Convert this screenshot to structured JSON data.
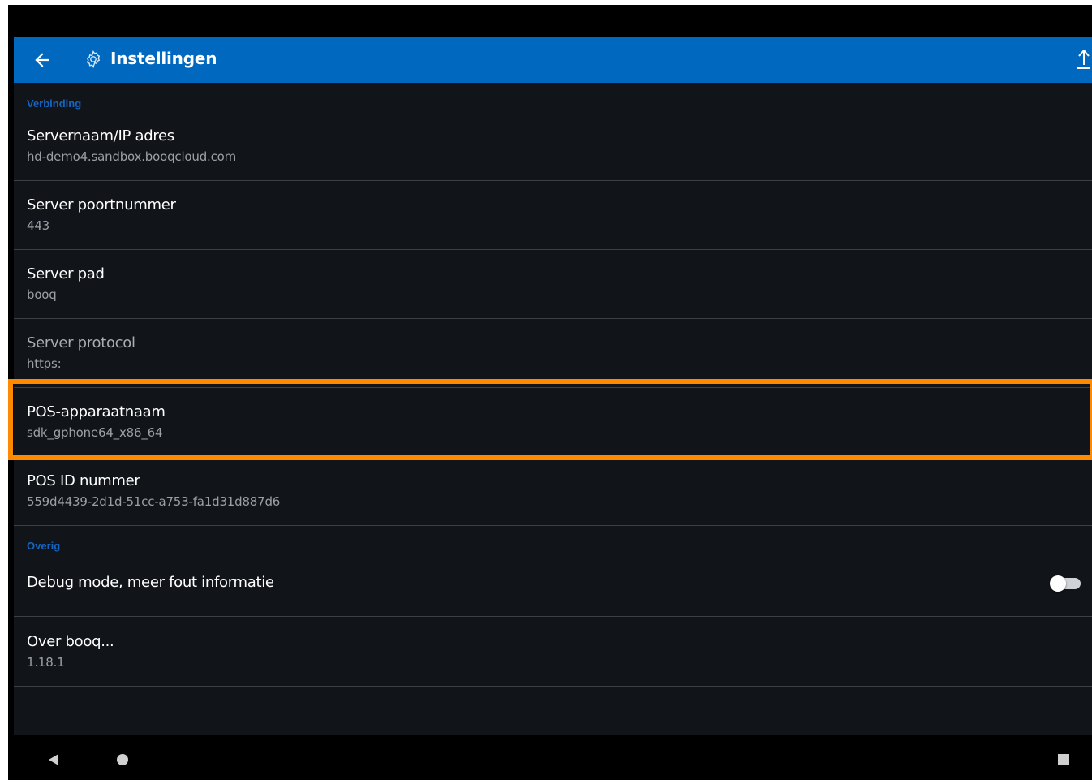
{
  "appbar": {
    "title": "Instellingen",
    "accent_color": "#0068bf",
    "icons": [
      "back-arrow-icon",
      "gear-icon",
      "upload-icon"
    ]
  },
  "sections": [
    {
      "header": "Verbinding",
      "items": [
        {
          "title": "Servernaam/IP adres",
          "value": "hd-demo4.sandbox.booqcloud.com"
        },
        {
          "title": "Server poortnummer",
          "value": "443"
        },
        {
          "title": "Server pad",
          "value": "booq"
        },
        {
          "title": "Server protocol",
          "value": "https:",
          "disabled": true
        },
        {
          "title": "POS-apparaatnaam",
          "value": "sdk_gphone64_x86_64",
          "highlighted": true
        },
        {
          "title": "POS ID nummer",
          "value": "559d4439-2d1d-51cc-a753-fa1d31d887d6"
        }
      ]
    },
    {
      "header": "Overig",
      "items": [
        {
          "title": "Debug mode, meer fout informatie",
          "toggle_on": false
        },
        {
          "title": "Over booq...",
          "value": "1.18.1"
        }
      ]
    }
  ],
  "highlight_color": "#ff8a00",
  "navbar": {
    "icons": [
      "nav-back-icon",
      "nav-home-icon",
      "nav-recents-icon"
    ]
  }
}
